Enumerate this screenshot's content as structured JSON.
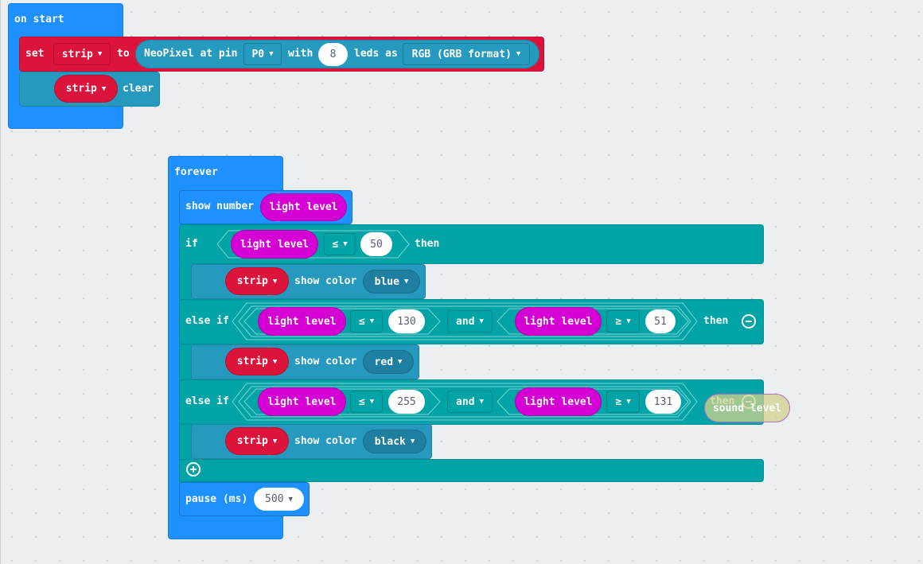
{
  "colors": {
    "events": "#1e90ff",
    "variables": "#dc143c",
    "neopixel": "#2699bf",
    "logic": "#00a4a6",
    "input": "#d400d4"
  },
  "on_start": {
    "label": "on start",
    "set": {
      "label": "set",
      "variable": "strip",
      "to": "to",
      "neopixel_label": "NeoPixel at pin",
      "pin": "P0",
      "with": "with",
      "leds": "8",
      "leds_as": "leds as",
      "format": "RGB (GRB format)"
    },
    "clear": {
      "variable": "strip",
      "label": "clear"
    }
  },
  "forever": {
    "label": "forever",
    "show_number": {
      "label": "show number",
      "value": "light level"
    },
    "if": {
      "label": "if",
      "left": "light level",
      "op": "≤",
      "right": "50",
      "then": "then",
      "body": {
        "variable": "strip",
        "label": "show color",
        "color": "blue"
      }
    },
    "else_ifs": [
      {
        "label": "else if",
        "a_left": "light level",
        "a_op": "≤",
        "a_right": "130",
        "join": "and",
        "b_left": "light level",
        "b_op": "≥",
        "b_right": "51",
        "then": "then",
        "body": {
          "variable": "strip",
          "label": "show color",
          "color": "red"
        }
      },
      {
        "label": "else if",
        "a_left": "light level",
        "a_op": "≤",
        "a_right": "255",
        "join": "and",
        "b_left": "light level",
        "b_op": "≥",
        "b_right": "131",
        "then": "then",
        "body": {
          "variable": "strip",
          "label": "show color",
          "color": "black"
        }
      }
    ],
    "pause": {
      "label": "pause (ms)",
      "value": "500"
    }
  },
  "drag_ghost": {
    "label": "sound level"
  },
  "icons": {
    "dropdown": "caret-down-icon",
    "remove": "minus-circle-icon",
    "add": "plus-circle-icon"
  }
}
